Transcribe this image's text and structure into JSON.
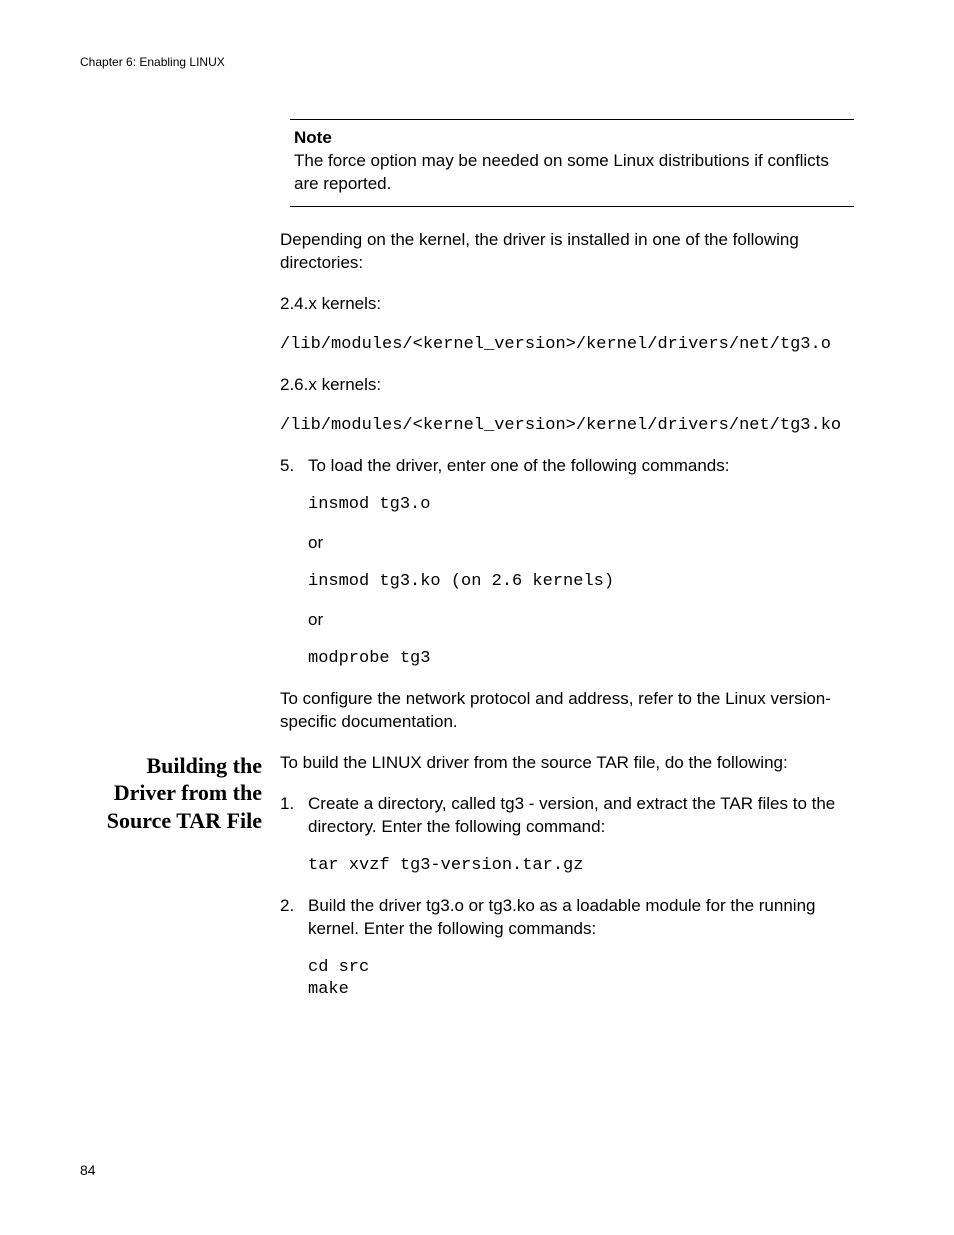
{
  "header": {
    "running": "Chapter 6: Enabling LINUX"
  },
  "note": {
    "title": "Note",
    "body": "The force option may be needed on some Linux distributions if conflicts are reported."
  },
  "para": {
    "depending": "Depending on the kernel, the driver is installed in one of the following directories:",
    "k24": "2.4.x kernels:",
    "path24": "/lib/modules/<kernel_version>/kernel/drivers/net/tg3.o",
    "k26": "2.6.x kernels:",
    "path26": "/lib/modules/<kernel_version>/kernel/drivers/net/tg3.ko",
    "step5_intro": "To load the driver, enter one of the following commands:",
    "cmd_insmod_o": "insmod tg3.o",
    "or1": "or",
    "cmd_insmod_ko": "insmod tg3.ko (on 2.6 kernels)",
    "or2": "or",
    "cmd_modprobe": "modprobe tg3",
    "configure": "To configure the network protocol and address, refer to the Linux version-specific documentation."
  },
  "section2": {
    "heading": "Building the Driver from the Source TAR File",
    "intro": "To build the LINUX driver from the source TAR file, do the following:",
    "step1": "Create a directory, called tg3 - version, and extract the TAR files to the directory. Enter the following command:",
    "cmd_tar": "tar xvzf tg3-version.tar.gz",
    "step2": "Build the driver tg3.o or tg3.ko as a loadable module for the running kernel. Enter the following commands:",
    "cmd_cd": "cd src",
    "cmd_make": "make"
  },
  "footer": {
    "page": "84"
  }
}
